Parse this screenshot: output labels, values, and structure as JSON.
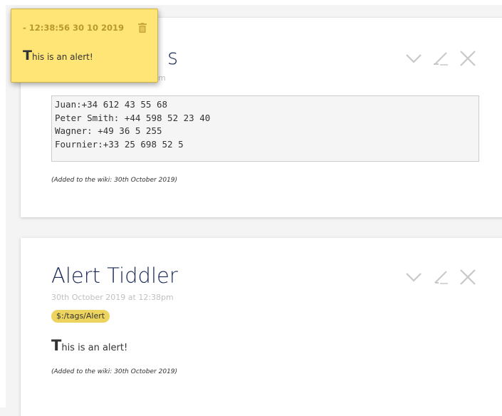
{
  "alert": {
    "header": "- 12:38:56 30 10 2019",
    "text_initial": "T",
    "text_rest": "his is an alert!",
    "delete_icon": "trash-icon"
  },
  "tiddlers": [
    {
      "title": "s",
      "subtitle": "m",
      "code_lines": [
        "Juan:+34 612 43 55 68",
        "Peter Smith: +44 598 52 23 40",
        "Wagner: +49 36 5 255",
        "Fournier:+33 25 698 52 5"
      ],
      "added_note": "(Added to the wiki: 30th October 2019)"
    },
    {
      "title": "Alert Tiddler",
      "subtitle": "30th October 2019 at 12:38pm",
      "tag": "$:/tags/Alert",
      "text_initial": "T",
      "text_rest": "his is an alert!",
      "added_note": "(Added to the wiki: 30th October 2019)"
    }
  ],
  "controls": {
    "collapse_icon": "chevron-down-icon",
    "edit_icon": "pencil-icon",
    "close_icon": "close-icon"
  },
  "colors": {
    "title": "#182955",
    "alert_bg": "#ffe476",
    "alert_header": "#b89a2b",
    "tag_bg": "#ecd45f",
    "control": "#c8c8c8"
  }
}
